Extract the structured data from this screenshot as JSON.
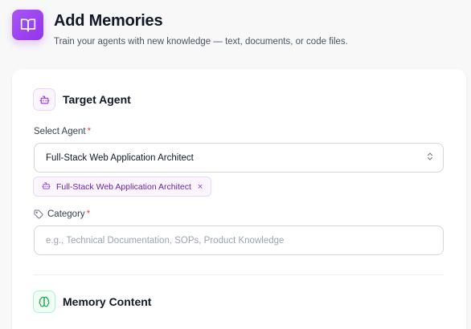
{
  "header": {
    "title": "Add Memories",
    "subtitle": "Train your agents with new knowledge — text, documents, or code files.",
    "logo_icon": "book-open-icon"
  },
  "target_agent": {
    "title": "Target Agent",
    "icon": "bot-icon",
    "select_label": "Select Agent",
    "required_mark": "*",
    "selected_value": "Full-Stack Web Application Architect",
    "chip_label": "Full-Stack Web Application Architect",
    "chip_close": "×"
  },
  "category": {
    "label": "Category",
    "required_mark": "*",
    "placeholder": "e.g., Technical Documentation, SOPs, Product Knowledge",
    "value": ""
  },
  "memory_content": {
    "title": "Memory Content",
    "icon": "brain-icon"
  },
  "colors": {
    "accent": "#9333ea",
    "required": "#ef4444",
    "green": "#16a34a"
  }
}
